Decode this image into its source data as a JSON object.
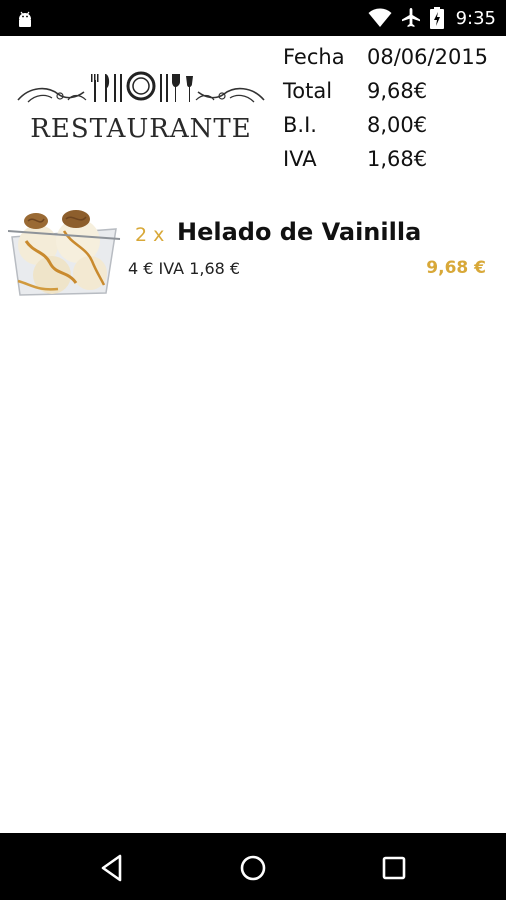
{
  "status_bar": {
    "time": "9:35",
    "icons": [
      "android-icon",
      "wifi-icon",
      "airplane-icon",
      "battery-icon"
    ]
  },
  "header": {
    "logo_text": "RESTAURANTE"
  },
  "summary": {
    "rows": [
      {
        "label": "Fecha",
        "value": "08/06/2015"
      },
      {
        "label": "Total",
        "value": "9,68€"
      },
      {
        "label": "B.I.",
        "value": "8,00€"
      },
      {
        "label": "IVA",
        "value": "1,68€"
      }
    ]
  },
  "items": [
    {
      "quantity": "2 x",
      "name": "Helado de Vainilla",
      "detail": "4 € IVA 1,68 €",
      "total": "9,68 €",
      "image_icon": "ice-cream-image"
    }
  ],
  "colors": {
    "accent": "#d8a838",
    "status_bar": "#000000",
    "nav_bar": "#000000"
  },
  "nav_bar": {
    "buttons": [
      "back-icon",
      "home-icon",
      "recents-icon"
    ]
  }
}
